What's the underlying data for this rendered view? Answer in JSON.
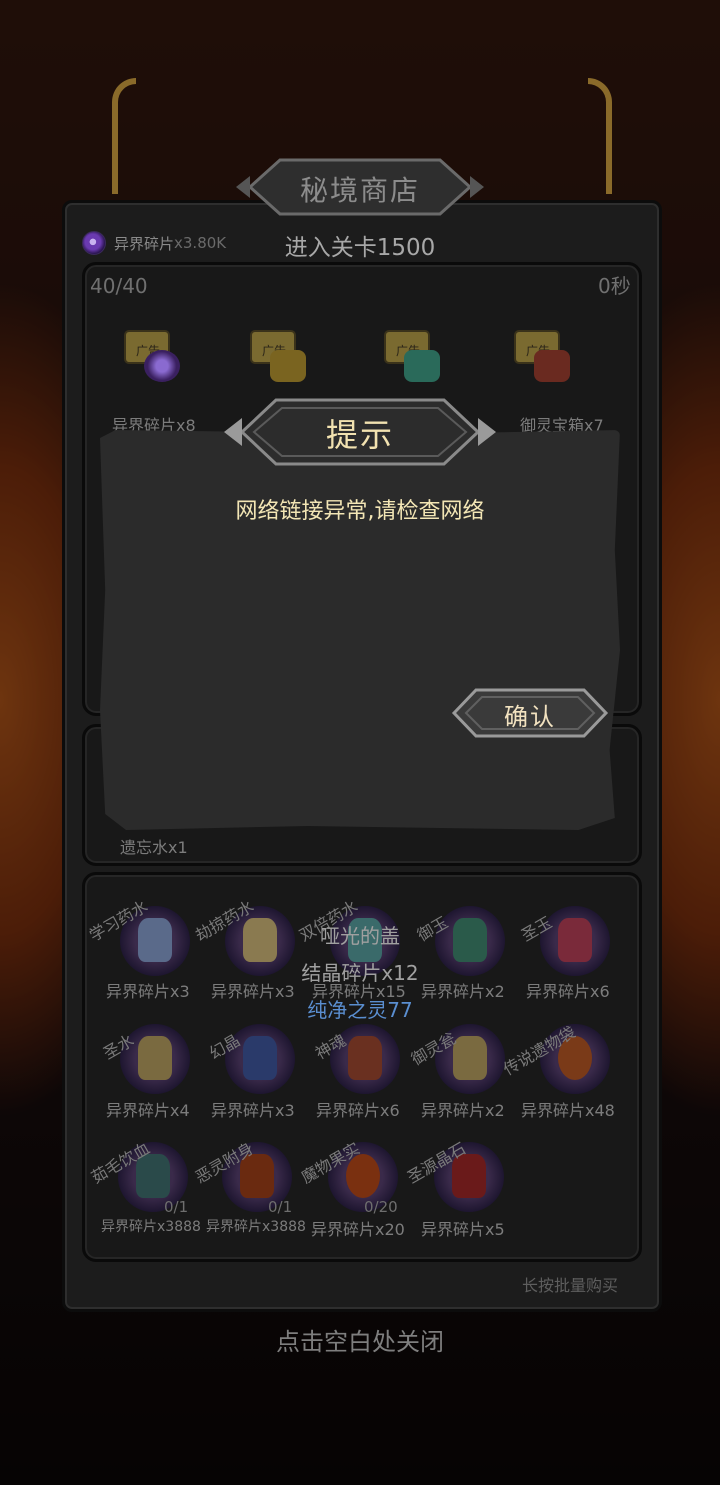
{
  "shop": {
    "title": "秘境商店",
    "currency": {
      "icon": "void-orb-icon",
      "label": "异界碎片",
      "amount": "x3.80K"
    },
    "stage_label": "进入关卡1500",
    "ad_section": {
      "counter": "40/40",
      "timer": "0秒",
      "ad_badge": "广告",
      "items": [
        {
          "name": "异界碎片x8",
          "icon": "void-orb-icon"
        },
        {
          "name": "",
          "icon": "gold-chest-icon"
        },
        {
          "name": "",
          "icon": "teal-chest-icon"
        },
        {
          "name": "御灵宝箱x7",
          "icon": "red-chest-icon"
        }
      ]
    },
    "middle_section": {
      "item_label": "遗忘水x1"
    },
    "grid": [
      {
        "tag": "学习药水",
        "price": "异界碎片x3",
        "count": "",
        "icon": "potion-flask-icon"
      },
      {
        "tag": "劫掠药水",
        "price": "异界碎片x3",
        "count": "",
        "icon": "potion-flask-icon"
      },
      {
        "tag": "双倍药水",
        "price": "异界碎片x15",
        "count": "",
        "icon": "potion-jar-icon"
      },
      {
        "tag": "御玉",
        "price": "异界碎片x2",
        "count": "",
        "icon": "jade-icon"
      },
      {
        "tag": "圣玉",
        "price": "异界碎片x6",
        "count": "",
        "icon": "holy-jade-icon"
      },
      {
        "tag": "圣水",
        "price": "异界碎片x4",
        "count": "",
        "icon": "holy-water-icon"
      },
      {
        "tag": "幻晶",
        "price": "异界碎片x3",
        "count": "",
        "icon": "crystal-icon"
      },
      {
        "tag": "神魂",
        "price": "异界碎片x6",
        "count": "",
        "icon": "soul-icon"
      },
      {
        "tag": "御灵瓮",
        "price": "异界碎片x2",
        "count": "",
        "icon": "urn-icon"
      },
      {
        "tag": "传说遗物袋",
        "price": "异界碎片x48",
        "count": "",
        "icon": "relic-bag-icon"
      },
      {
        "tag": "茹毛饮血",
        "price": "异界碎片x3888",
        "count": "0/1",
        "icon": "savage-icon"
      },
      {
        "tag": "恶灵附身",
        "price": "异界碎片x3888",
        "count": "0/1",
        "icon": "evil-spirit-icon"
      },
      {
        "tag": "魔物果实",
        "price": "异界碎片x20",
        "count": "0/20",
        "icon": "monster-fruit-icon"
      },
      {
        "tag": "圣源晶石",
        "price": "异界碎片x5",
        "count": "",
        "icon": "holy-stone-icon"
      }
    ],
    "overlay_lines": [
      "哑光的盖",
      "结晶碎片x12",
      "纯净之灵77"
    ],
    "batch_hint": "长按批量购买",
    "close_hint": "点击空白处关闭"
  },
  "dialog": {
    "title": "提示",
    "message": "网络链接异常,请检查网络",
    "confirm_label": "确认"
  },
  "colors": {
    "dialog_text": "#f3e6b5",
    "overlay_highlight": "#5a8ed0",
    "panel_bg": "#1c1c1c"
  }
}
